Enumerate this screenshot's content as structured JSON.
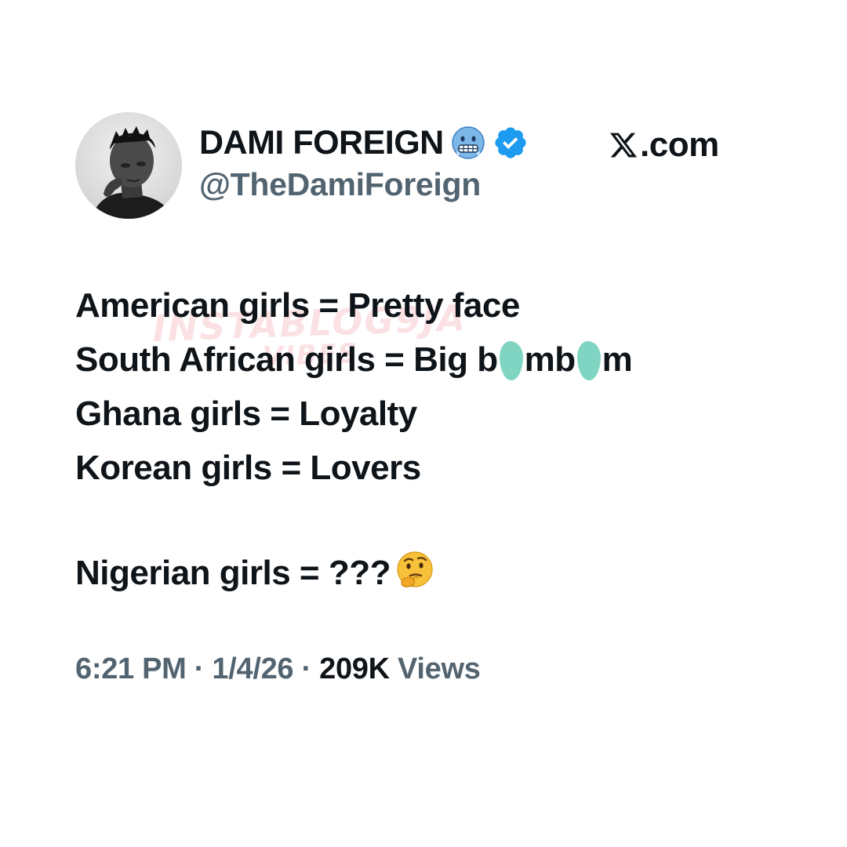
{
  "author": {
    "display_name": "DAMI FOREIGN",
    "handle": "@TheDamiForeign",
    "name_emoji_icon": "cold-face-emoji-icon",
    "verified_icon": "verified-badge-icon",
    "verified_color": "#1d9bf0"
  },
  "brand": {
    "logo_icon": "x-logo-icon",
    "text": ".com"
  },
  "tweet": {
    "lines": [
      "American girls = Pretty face",
      "South African girls = Big b",
      "Ghana girls = Loyalty",
      "Korean girls = Lovers"
    ],
    "line2_mid": "mb",
    "line2_end": "m",
    "censor_color": "#7fd5c2",
    "question_line": "Nigerian girls = ???",
    "question_emoji_icon": "thinking-face-emoji-icon"
  },
  "watermark": {
    "line1": "INSTABLOG9JA",
    "line2": "VIBES"
  },
  "meta": {
    "time": "6:21 PM",
    "separator": " · ",
    "date": "1/4/26",
    "views_count": "209K",
    "views_label": "Views"
  },
  "colors": {
    "text_primary": "#0f1419",
    "text_secondary": "#536471",
    "background": "#ffffff"
  }
}
